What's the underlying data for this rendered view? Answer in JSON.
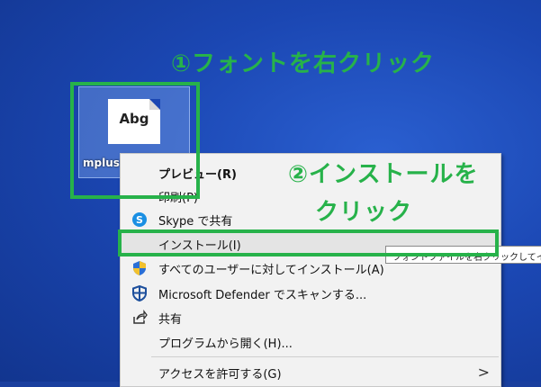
{
  "annotations": {
    "step1": "①フォントを右クリック",
    "step2_line1": "②インストールを",
    "step2_line2": "クリック"
  },
  "desktop": {
    "file_icon_text": "Abg",
    "file_name": "mplus"
  },
  "menu": {
    "items": [
      {
        "label": "プレビュー(R)",
        "icon": "none"
      },
      {
        "label": "印刷(P)",
        "icon": "none"
      },
      {
        "label": "Skype で共有",
        "icon": "skype-icon"
      },
      {
        "label": "インストール(I)",
        "icon": "none"
      },
      {
        "label": "すべてのユーザーに対してインストール(A)",
        "icon": "uac-shield-icon"
      },
      {
        "label": "Microsoft Defender でスキャンする...",
        "icon": "defender-icon"
      },
      {
        "label": "共有",
        "icon": "share-icon"
      },
      {
        "label": "プログラムから開く(H)...",
        "icon": "none"
      },
      {
        "label": "アクセスを許可する(G)",
        "icon": "none"
      }
    ],
    "submenu_arrow": ">"
  },
  "tooltip": {
    "text": "フォントファイルを右クリックしてインス"
  },
  "colors": {
    "annotation_green": "#27b24a",
    "desktop_blue": "#1b47b3",
    "menu_bg": "#f2f2f2"
  }
}
